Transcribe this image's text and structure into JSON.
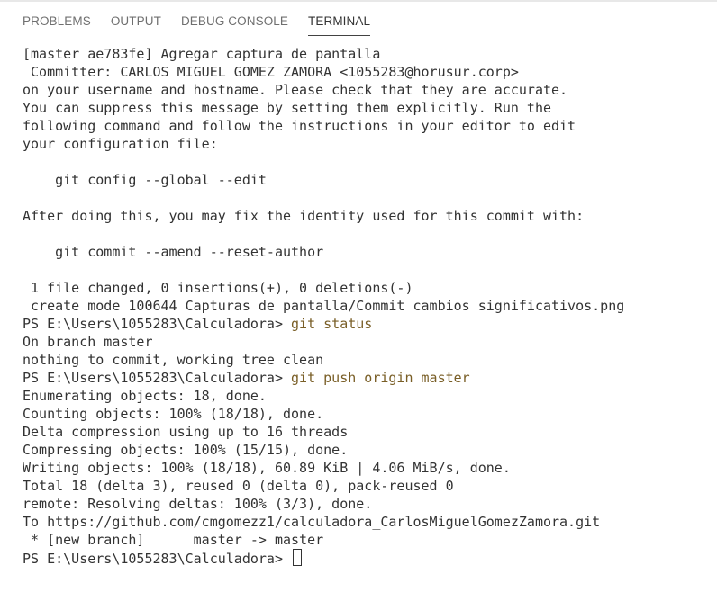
{
  "tabs": [
    {
      "label": "PROBLEMS"
    },
    {
      "label": "OUTPUT"
    },
    {
      "label": "DEBUG CONSOLE"
    },
    {
      "label": "TERMINAL"
    }
  ],
  "terminal": {
    "lines": [
      "[master ae783fe] Agregar captura de pantalla",
      " Committer: CARLOS MIGUEL GOMEZ ZAMORA <1055283@horusur.corp>",
      "on your username and hostname. Please check that they are accurate.",
      "You can suppress this message by setting them explicitly. Run the",
      "following command and follow the instructions in your editor to edit",
      "your configuration file:",
      "",
      "    git config --global --edit",
      "",
      "After doing this, you may fix the identity used for this commit with:",
      "",
      "    git commit --amend --reset-author",
      "",
      " 1 file changed, 0 insertions(+), 0 deletions(-)",
      " create mode 100644 Capturas de pantalla/Commit cambios significativos.png"
    ],
    "prompt1": "PS E:\\Users\\1055283\\Calculadora> ",
    "command1": "git status",
    "lines2": [
      "On branch master",
      "nothing to commit, working tree clean"
    ],
    "prompt2": "PS E:\\Users\\1055283\\Calculadora> ",
    "command2": "git push origin master",
    "lines3": [
      "Enumerating objects: 18, done.",
      "Counting objects: 100% (18/18), done.",
      "Delta compression using up to 16 threads",
      "Compressing objects: 100% (15/15), done.",
      "Writing objects: 100% (18/18), 60.89 KiB | 4.06 MiB/s, done.",
      "Total 18 (delta 3), reused 0 (delta 0), pack-reused 0",
      "remote: Resolving deltas: 100% (3/3), done.",
      "To https://github.com/cmgomezz1/calculadora_CarlosMiguelGomezZamora.git",
      " * [new branch]      master -> master"
    ],
    "prompt3": "PS E:\\Users\\1055283\\Calculadora> "
  },
  "colors": {
    "text": "#333333",
    "command": "#795e26",
    "tab_inactive": "#6f6f6f",
    "tab_active": "#333333"
  }
}
